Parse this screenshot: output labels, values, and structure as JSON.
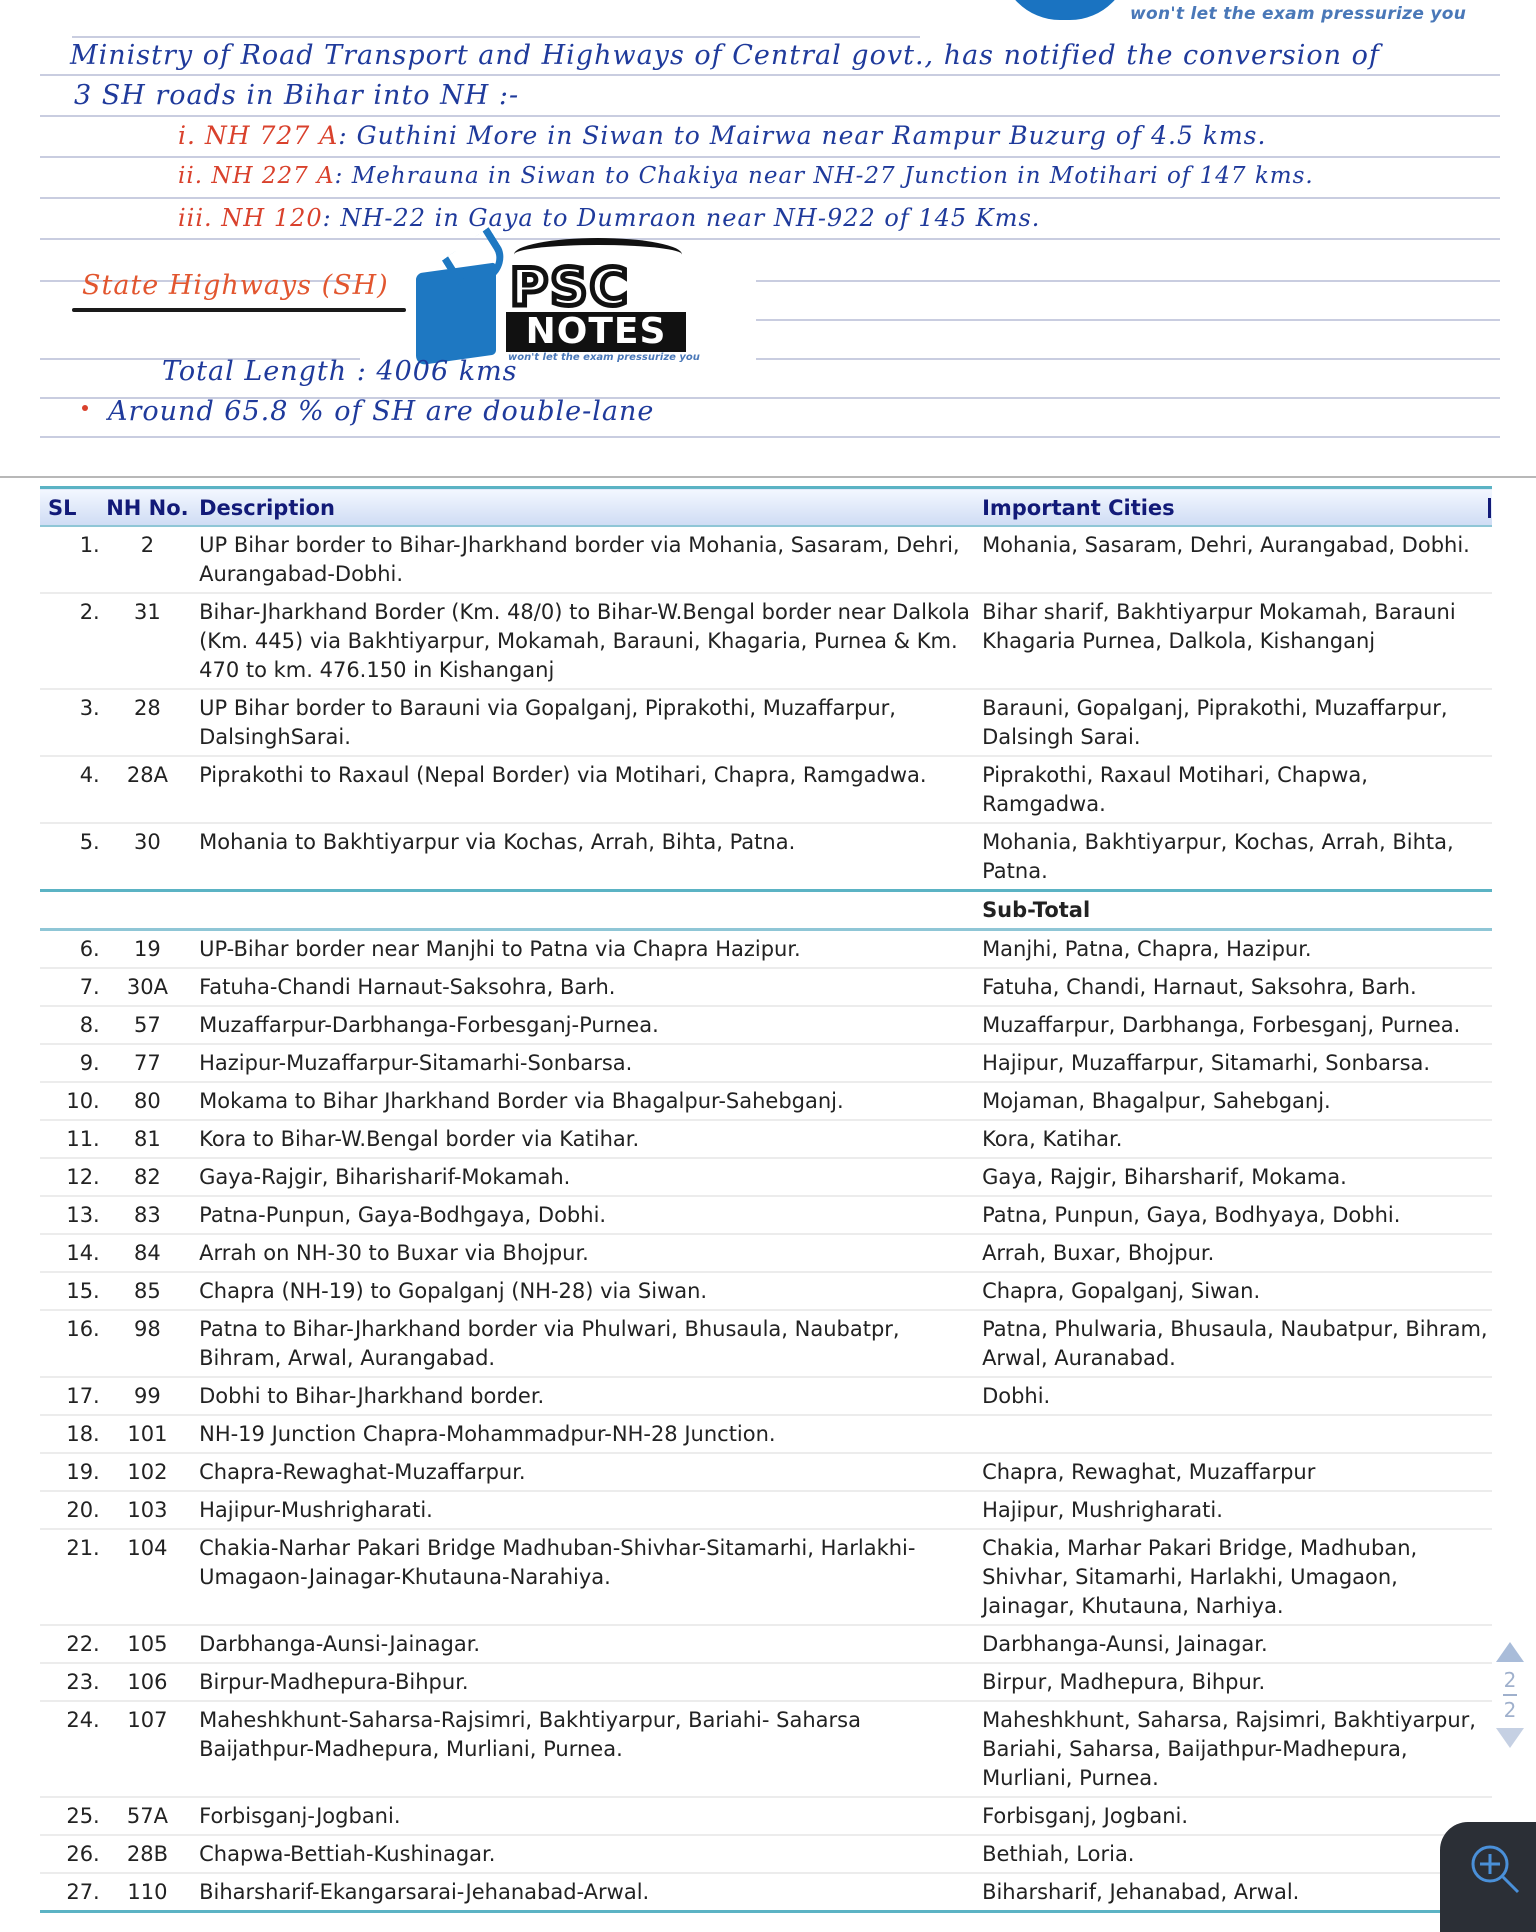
{
  "notes": {
    "top_tagline": "won't let the exam pressurize you",
    "intro_line1": "Ministry of Road Transport and Highways of Central govt., has notified the conversion of",
    "intro_line2": "3 SH roads in Bihar into NH :-",
    "conversions": [
      {
        "marker": "i.",
        "nh": "NH 727 A",
        "text": ": Guthini More in Siwan to Mairwa near Rampur Buzurg of 4.5 kms."
      },
      {
        "marker": "ii.",
        "nh": "NH 227 A",
        "text": ": Mehrauna in Siwan to Chakiya near NH-27 Junction in Motihari of 147 kms."
      },
      {
        "marker": "iii.",
        "nh": "NH 120",
        "text": ": NH-22 in Gaya to Dumraon near NH-922 of 145 Kms."
      }
    ],
    "state_highways_title": "State Highways (SH)",
    "total_length": "Total Length : 4006 kms",
    "double_lane_note": "Around 65.8 % of SH are double-lane"
  },
  "logo": {
    "psc": "PSC",
    "notes": "NOTES",
    "tagline": "won't let the exam pressurize you"
  },
  "table": {
    "headers": {
      "sl": "SL",
      "nh": "NH No.",
      "description": "Description",
      "cities": "Important Cities"
    },
    "rows_group1": [
      {
        "sl": "1.",
        "nh": "2",
        "description": "UP Bihar border to Bihar-Jharkhand border via Mohania, Sasaram, Dehri, Aurangabad-Dobhi.",
        "cities": "Mohania, Sasaram, Dehri, Aurangabad, Dobhi."
      },
      {
        "sl": "2.",
        "nh": "31",
        "description": "Bihar-Jharkhand Border (Km. 48/0) to Bihar-W.Bengal border near Dalkola (Km. 445) via Bakhtiyarpur, Mokamah, Barauni, Khagaria, Purnea & Km. 470 to km. 476.150 in Kishanganj",
        "cities": "Bihar sharif, Bakhtiyarpur Mokamah, Barauni Khagaria Purnea, Dalkola, Kishanganj"
      },
      {
        "sl": "3.",
        "nh": "28",
        "description": "UP Bihar border to Barauni via Gopalganj, Piprakothi, Muzaffarpur, DalsinghSarai.",
        "cities": "Barauni, Gopalganj, Piprakothi, Muzaffarpur, Dalsingh Sarai."
      },
      {
        "sl": "4.",
        "nh": "28A",
        "description": "Piprakothi to Raxaul (Nepal Border) via Motihari, Chapra, Ramgadwa.",
        "cities": "Piprakothi, Raxaul Motihari, Chapwa, Ramgadwa."
      },
      {
        "sl": "5.",
        "nh": "30",
        "description": "Mohania to Bakhtiyarpur via Kochas, Arrah, Bihta, Patna.",
        "cities": "Mohania, Bakhtiyarpur, Kochas, Arrah, Bihta, Patna."
      }
    ],
    "subtotal_label": "Sub-Total",
    "rows_group2": [
      {
        "sl": "6.",
        "nh": "19",
        "description": "UP-Bihar border near Manjhi to Patna via Chapra Hazipur.",
        "cities": "Manjhi, Patna, Chapra, Hazipur."
      },
      {
        "sl": "7.",
        "nh": "30A",
        "description": "Fatuha-Chandi Harnaut-Saksohra, Barh.",
        "cities": "Fatuha, Chandi, Harnaut, Saksohra, Barh."
      },
      {
        "sl": "8.",
        "nh": "57",
        "description": "Muzaffarpur-Darbhanga-Forbesganj-Purnea.",
        "cities": "Muzaffarpur, Darbhanga, Forbesganj, Purnea."
      },
      {
        "sl": "9.",
        "nh": "77",
        "description": "Hazipur-Muzaffarpur-Sitamarhi-Sonbarsa.",
        "cities": "Hajipur, Muzaffarpur, Sitamarhi, Sonbarsa."
      },
      {
        "sl": "10.",
        "nh": "80",
        "description": "Mokama to Bihar Jharkhand Border via Bhagalpur-Sahebganj.",
        "cities": "Mojaman, Bhagalpur, Sahebganj."
      },
      {
        "sl": "11.",
        "nh": "81",
        "description": "Kora to Bihar-W.Bengal border via Katihar.",
        "cities": "Kora, Katihar."
      },
      {
        "sl": "12.",
        "nh": "82",
        "description": "Gaya-Rajgir, Biharisharif-Mokamah.",
        "cities": "Gaya, Rajgir, Biharsharif, Mokama."
      },
      {
        "sl": "13.",
        "nh": "83",
        "description": "Patna-Punpun, Gaya-Bodhgaya, Dobhi.",
        "cities": "Patna, Punpun, Gaya, Bodhyaya, Dobhi."
      },
      {
        "sl": "14.",
        "nh": "84",
        "description": "Arrah on NH-30 to Buxar via Bhojpur.",
        "cities": "Arrah, Buxar, Bhojpur."
      },
      {
        "sl": "15.",
        "nh": "85",
        "description": "Chapra (NH-19) to Gopalganj (NH-28) via Siwan.",
        "cities": "Chapra, Gopalganj, Siwan."
      },
      {
        "sl": "16.",
        "nh": "98",
        "description": "Patna to Bihar-Jharkhand border via Phulwari, Bhusaula, Naubatpr, Bihram, Arwal, Aurangabad.",
        "cities": "Patna, Phulwaria, Bhusaula, Naubatpur, Bihram, Arwal, Auranabad."
      },
      {
        "sl": "17.",
        "nh": "99",
        "description": "Dobhi to Bihar-Jharkhand border.",
        "cities": "Dobhi."
      },
      {
        "sl": "18.",
        "nh": "101",
        "description": "NH-19 Junction Chapra-Mohammadpur-NH-28 Junction.",
        "cities": ""
      },
      {
        "sl": "19.",
        "nh": "102",
        "description": "Chapra-Rewaghat-Muzaffarpur.",
        "cities": "Chapra, Rewaghat, Muzaffarpur"
      },
      {
        "sl": "20.",
        "nh": "103",
        "description": "Hajipur-Mushrigharati.",
        "cities": "Hajipur, Mushrigharati."
      },
      {
        "sl": "21.",
        "nh": "104",
        "description": "Chakia-Narhar Pakari Bridge Madhuban-Shivhar-Sitamarhi, Harlakhi-Umagaon-Jainagar-Khutauna-Narahiya.",
        "cities": "Chakia, Marhar Pakari Bridge, Madhuban, Shivhar, Sitamarhi, Harlakhi, Umagaon, Jainagar, Khutauna, Narhiya."
      },
      {
        "sl": "22.",
        "nh": "105",
        "description": "Darbhanga-Aunsi-Jainagar.",
        "cities": "Darbhanga-Aunsi, Jainagar."
      },
      {
        "sl": "23.",
        "nh": "106",
        "description": "Birpur-Madhepura-Bihpur.",
        "cities": "Birpur, Madhepura, Bihpur."
      },
      {
        "sl": "24.",
        "nh": "107",
        "description": "Maheshkhunt-Saharsa-Rajsimri, Bakhtiyarpur, Bariahi- Saharsa Baijathpur-Madhepura, Murliani, Purnea.",
        "cities": "Maheshkhunt, Saharsa, Rajsimri, Bakhtiyarpur, Bariahi, Saharsa, Baijathpur-Madhepura, Murliani, Purnea."
      },
      {
        "sl": "25.",
        "nh": "57A",
        "description": "Forbisganj-Jogbani.",
        "cities": "Forbisganj, Jogbani."
      },
      {
        "sl": "26.",
        "nh": "28B",
        "description": "Chapwa-Bettiah-Kushinagar.",
        "cities": "Bethiah, Loria."
      },
      {
        "sl": "27.",
        "nh": "110",
        "description": "Biharsharif-Ekangarsarai-Jehanabad-Arwal.",
        "cities": "Biharsharif, Jehanabad, Arwal."
      }
    ]
  },
  "pager": {
    "current": "2",
    "total": "2",
    "up_icon": "triangle-up",
    "down_icon": "triangle-down"
  },
  "zoom_button": {
    "icon": "zoom-in-icon"
  }
}
